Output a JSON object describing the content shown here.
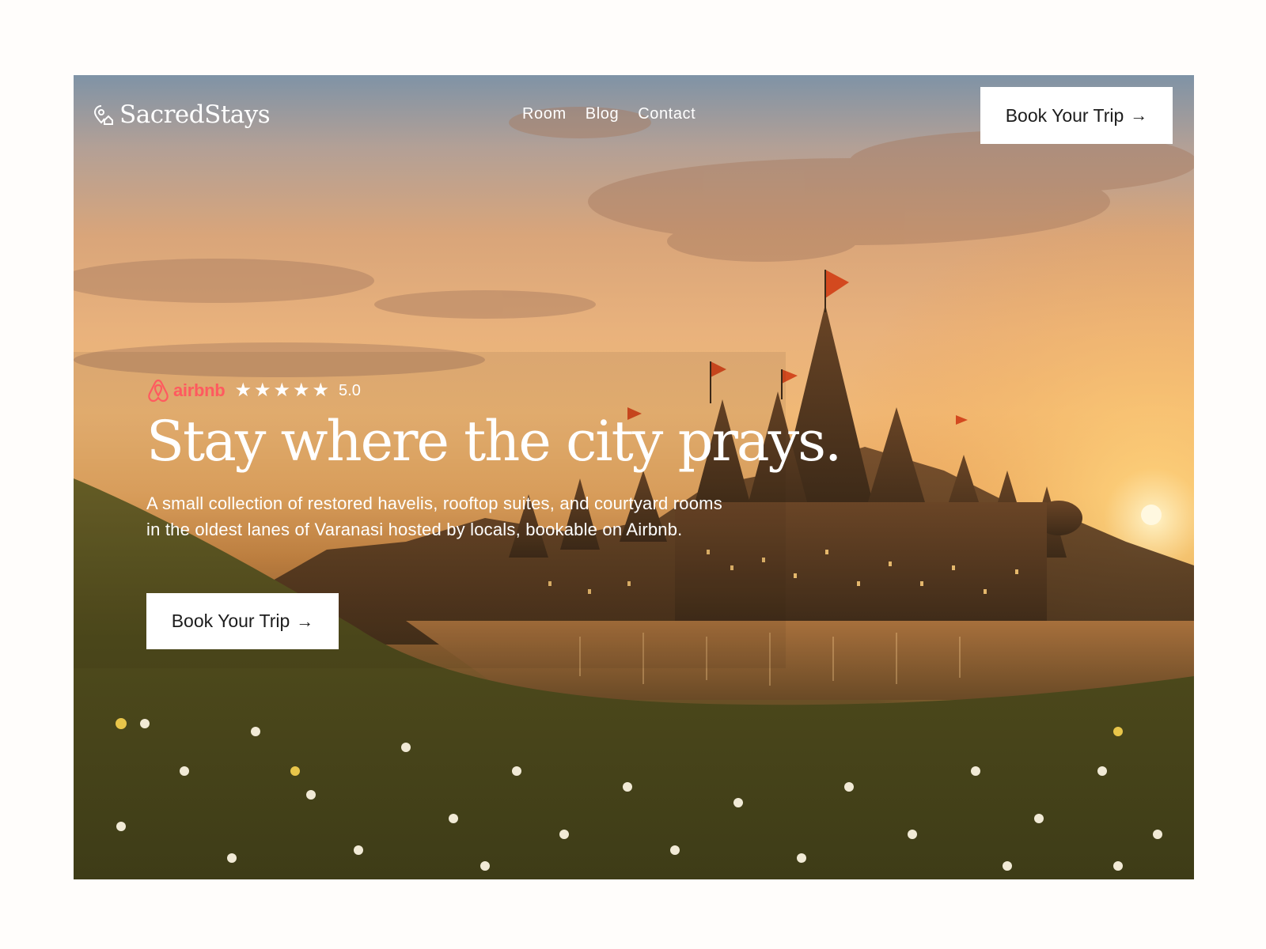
{
  "brand": {
    "name": "SacredStays",
    "logo_icon": "map-pin-house-icon"
  },
  "nav": {
    "items": [
      "Room",
      "Blog",
      "Contact"
    ]
  },
  "header_cta": {
    "label": "Book Your Trip",
    "icon": "arrow-right-icon"
  },
  "rating": {
    "platform": "airbnb",
    "stars": 5,
    "score": "5.0",
    "star_glyph": "★"
  },
  "hero": {
    "headline": "Stay where the city prays.",
    "subtext": "A small collection of restored havelis, rooftop suites, and courtyard rooms in the oldest lanes of Varanasi hosted by locals, bookable on Airbnb.",
    "cta": {
      "label": "Book Your Trip",
      "icon": "arrow-right-icon"
    },
    "background_image": "sunset-temple-ghats-river-flowers"
  },
  "colors": {
    "airbnb": "#ff5a5f",
    "button_bg": "#ffffff",
    "button_text": "#1c1c1c",
    "page_bg": "#fffdfb"
  }
}
